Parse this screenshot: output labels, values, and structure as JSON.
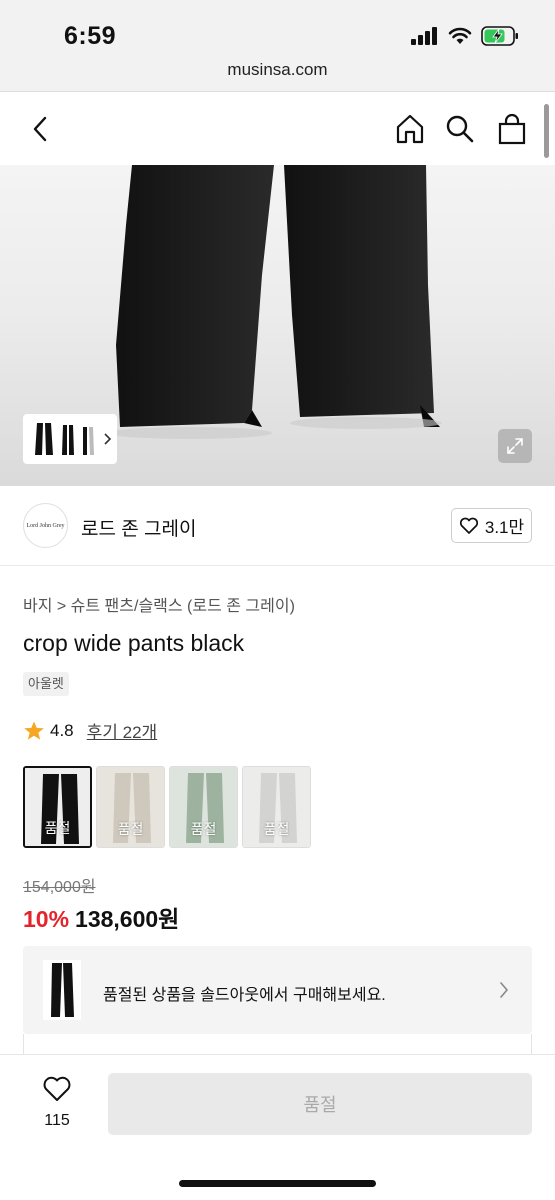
{
  "status_bar": {
    "time": "6:59",
    "url": "musinsa.com"
  },
  "icons": {
    "back": "chevron-left-icon",
    "home": "home-icon",
    "search": "search-icon",
    "cart": "shopping-bag-icon",
    "expand": "expand-icon",
    "heart": "heart-icon",
    "star": "star-icon"
  },
  "brand": {
    "logo_text": "Lord John Grey",
    "name": "로드 존 그레이",
    "likes": "3.1만"
  },
  "product": {
    "breadcrumb": "바지 > 슈트 팬츠/슬랙스 (로드 존 그레이)",
    "title": "crop wide pants black",
    "tag": "아울렛",
    "rating": "4.8",
    "review_link": "후기 22개"
  },
  "colors": [
    {
      "label": "품절",
      "color": "#111111",
      "selected": true
    },
    {
      "label": "품절",
      "color": "#cfc8bd",
      "selected": false
    },
    {
      "label": "품절",
      "color": "#9db39f",
      "selected": false
    },
    {
      "label": "품절",
      "color": "#d3d3d1",
      "selected": false
    }
  ],
  "pricing": {
    "original": "154,000원",
    "discount": "10%",
    "sale": "138,600원"
  },
  "soldout_banner": {
    "text": "품절된 상품을 솔드아웃에서 구매해보세요."
  },
  "bottom_bar": {
    "wish_count": "115",
    "buy_label": "품절"
  },
  "theme": {
    "accent_red": "#e5232a",
    "star": "#f5a623"
  }
}
